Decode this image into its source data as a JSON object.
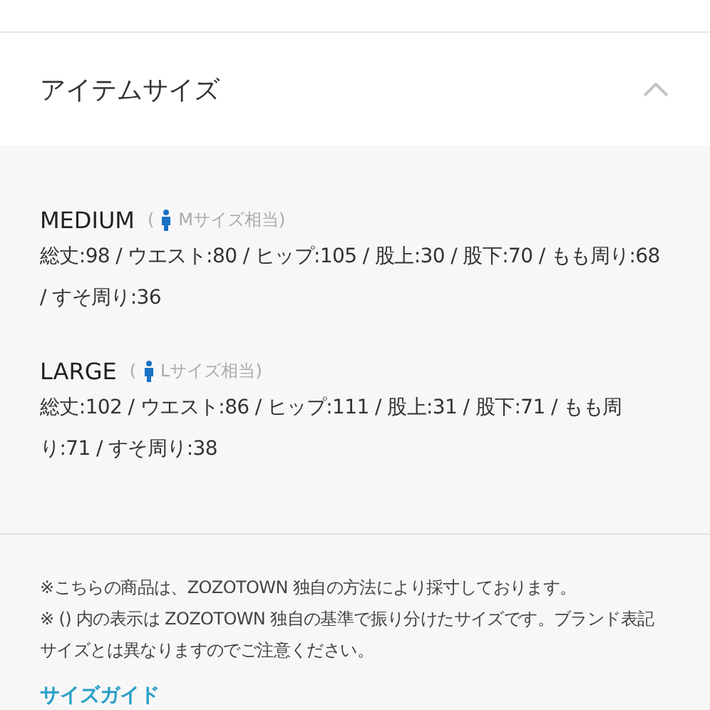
{
  "section": {
    "title": "アイテムサイズ",
    "expanded": true
  },
  "sizes": [
    {
      "name": "MEDIUM",
      "open_paren": "(",
      "equivalent": "Mサイズ相当",
      "close_paren": ")",
      "measurements": "総丈:98 / ウエスト:80 / ヒップ:105 / 股上:30 / 股下:70 / もも周り:68 / すそ周り:36"
    },
    {
      "name": "LARGE",
      "open_paren": "(",
      "equivalent": "Lサイズ相当",
      "close_paren": ")",
      "measurements": "総丈:102 / ウエスト:86 / ヒップ:111 / 股上:31 / 股下:71 / もも周り:71 / すそ周り:38"
    }
  ],
  "notes": [
    "※こちらの商品は、ZOZOTOWN 独自の方法により採寸しております。",
    "※ () 内の表示は ZOZOTOWN 独自の基準で振り分けたサイズです。ブランド表記サイズとは異なりますのでご注意ください。"
  ],
  "size_guide_link": "サイズガイド"
}
